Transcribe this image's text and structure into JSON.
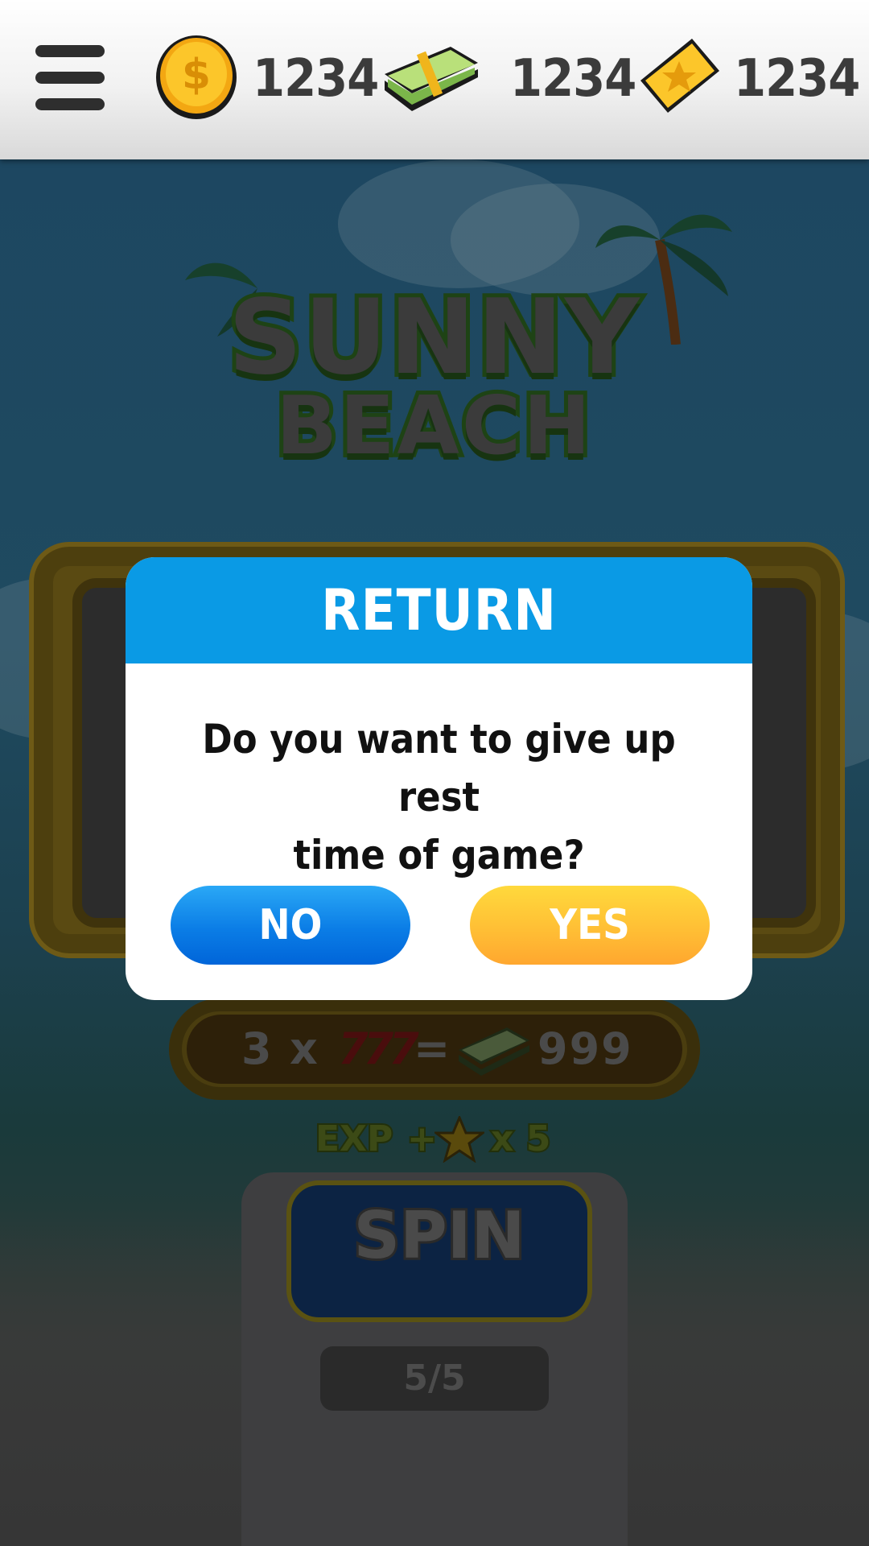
{
  "topbar": {
    "menu_icon": "hamburger-menu-icon",
    "coins": {
      "icon": "gold-coin-icon",
      "value": "1234"
    },
    "cash": {
      "icon": "cash-stack-icon",
      "value": "1234"
    },
    "tickets": {
      "icon": "star-ticket-icon",
      "value": "1234"
    }
  },
  "game": {
    "logo_line1": "SUNNY",
    "logo_line2": "BEACH",
    "reward": {
      "count": "3",
      "times": "x",
      "symbol": "777",
      "equals": "=",
      "amount": "999"
    },
    "exp": {
      "label": "EXP",
      "plus": "+",
      "multiplier": "x 5"
    },
    "spin_label": "SPIN",
    "spins_remaining": "5/5"
  },
  "modal": {
    "title": "RETURN",
    "message_line1": "Do you want to give up rest",
    "message_line2": "time of game?",
    "no_label": "NO",
    "yes_label": "YES"
  },
  "colors": {
    "modal_header": "#0a9ae5",
    "no_button": "#0b7de6",
    "yes_button": "#ffbf35",
    "overlay_dim": "#1c3f55"
  }
}
